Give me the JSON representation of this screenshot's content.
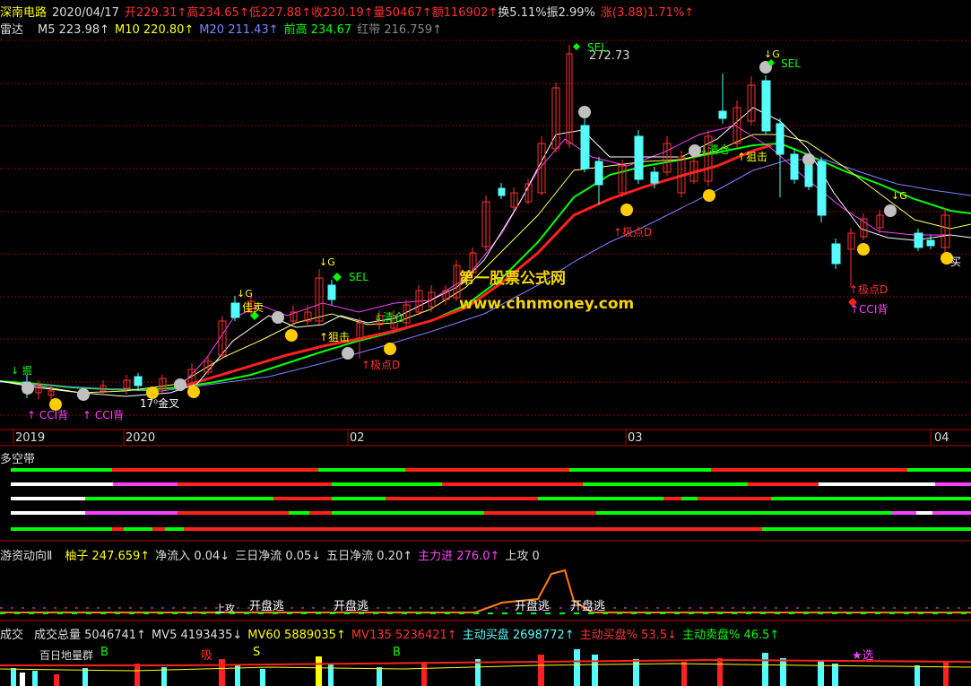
{
  "header": {
    "stock": "深南电路",
    "date": "2020/04/17",
    "open": "开229.31↑",
    "high": "高234.65↑",
    "low": "低227.88↑",
    "close": "收230.19↑",
    "volume": "量50467↑",
    "amount": "额116902↑",
    "turnover": "换5.11%",
    "amplitude": "振2.99%",
    "change": "涨(3.88)1.71%↑"
  },
  "ma_line": {
    "indicator": "雷达",
    "m5": "M5 223.98↑",
    "m10": "M10 220.80↑",
    "m20": "M20 211.43↑",
    "prev_high": "前高 234.67",
    "red_band": "红带 216.759↑"
  },
  "chart_labels": {
    "peak": "272.73",
    "watermark1": "第一股票公式网",
    "watermark2": "www.chnmoney.com",
    "sel1": "SEL",
    "sel2": "SEL",
    "sel3": "SEL",
    "g1": "↓G",
    "g2": "↓G",
    "g3": "↓G",
    "g4": "↓G",
    "jiamai": "佳卖",
    "zuji1": "↑狙击",
    "zuji2": "↑狙击",
    "qingcang1": "↓清仓",
    "qingcang2": "↓清仓",
    "jidian1": "↑极点D",
    "jidian2": "↑极点D",
    "jidian3": "↑极点D",
    "cci1": "↑ CCI背",
    "cci2": "↑ CCI背",
    "cci3": "↑CCI背",
    "jinjiao": "17⁰金叉",
    "buy": "买",
    "jue": "↓ 掘"
  },
  "time_axis": [
    "2019",
    "2020",
    "02",
    "03",
    "04"
  ],
  "duokong": {
    "title": "多空带"
  },
  "youzi": {
    "title": "游资动向Ⅱ",
    "youzi": "柚子 247.659↑",
    "jingliuru": "净流入 0.04↓",
    "sanri": "三日净流 0.05↓",
    "wuri": "五日净流 0.20↑",
    "zhuli": "主力进 276.0↑",
    "shanggong": "上攻 0",
    "open_escape": "开盘逃",
    "up_attack": "上攻"
  },
  "volume_pane": {
    "title": "成交",
    "total": "成交总量 5046741↑",
    "mv5": "MV5 4193435↓",
    "mv60": "MV60 5889035↑",
    "mv135": "MV135 5236421↑",
    "active_buy": "主动买盘 2698772↑",
    "active_buy_pct": "主动买盘% 53.5↓",
    "active_sell_pct": "主动卖盘% 46.5↑",
    "bottom_label": "百日地量群",
    "b": "B",
    "xi": "吸",
    "s": "S",
    "xuan": "★选"
  },
  "colors": {
    "up": "#ff3030",
    "down": "#54fcfc",
    "white": "#ffffff",
    "yellow": "#ffff00",
    "magenta": "#ff40ff",
    "green": "#00ff00",
    "blue": "#8080ff",
    "grid": "#8b0000"
  }
}
